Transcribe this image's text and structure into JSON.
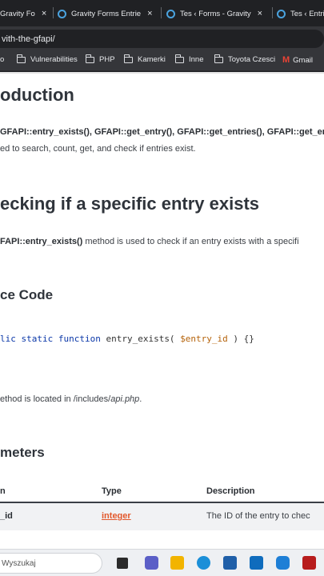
{
  "browser": {
    "tabs": [
      {
        "title": "Gravity Fo",
        "close": "×"
      },
      {
        "title": "Gravity Forms Entrie",
        "close": "×"
      },
      {
        "title": "Tes ‹ Forms - Gravity",
        "close": "×"
      },
      {
        "title": "Tes ‹ Entrie",
        "close": ""
      }
    ],
    "url": "vith-the-gfapi/",
    "bookmarks": [
      {
        "label": "o",
        "icon": "none"
      },
      {
        "label": "Vulnerabilities",
        "icon": "folder-icon"
      },
      {
        "label": "PHP",
        "icon": "folder-icon"
      },
      {
        "label": "Kamerki",
        "icon": "folder-icon"
      },
      {
        "label": "Inne",
        "icon": "folder-icon"
      },
      {
        "label": "Toyota Czesci",
        "icon": "folder-icon"
      },
      {
        "label": "Gmail",
        "icon": "gmail-icon"
      }
    ]
  },
  "content": {
    "intro_heading": "oduction",
    "intro_methods_line": "GFAPI::entry_exists(), GFAPI::get_entry(), GFAPI::get_entries(), GFAPI::get_er",
    "intro_desc": "ed to search, count, get, and check if entries exist.",
    "section_heading": "ecking if a specific entry exists",
    "section_desc_bold": "FAPI::entry_exists()",
    "section_desc_rest": " method is used to check if an entry exists with a specifi",
    "source_heading": "ce Code",
    "code": {
      "kw1": "lic static",
      "kw2": "function",
      "fn": " entry_exists( ",
      "var": "$entry_id",
      "end": " ) {}"
    },
    "location_prefix": "ethod is located in /includes/",
    "location_file": "api.php",
    "location_suffix": ".",
    "params_heading": "meters",
    "table": {
      "headers": [
        "n",
        "Type",
        "Description"
      ],
      "rows": [
        {
          "name": "_id",
          "type": "integer",
          "desc": "The ID of the entry to chec"
        }
      ]
    }
  },
  "taskbar": {
    "search_placeholder": "Wyszukaj"
  }
}
